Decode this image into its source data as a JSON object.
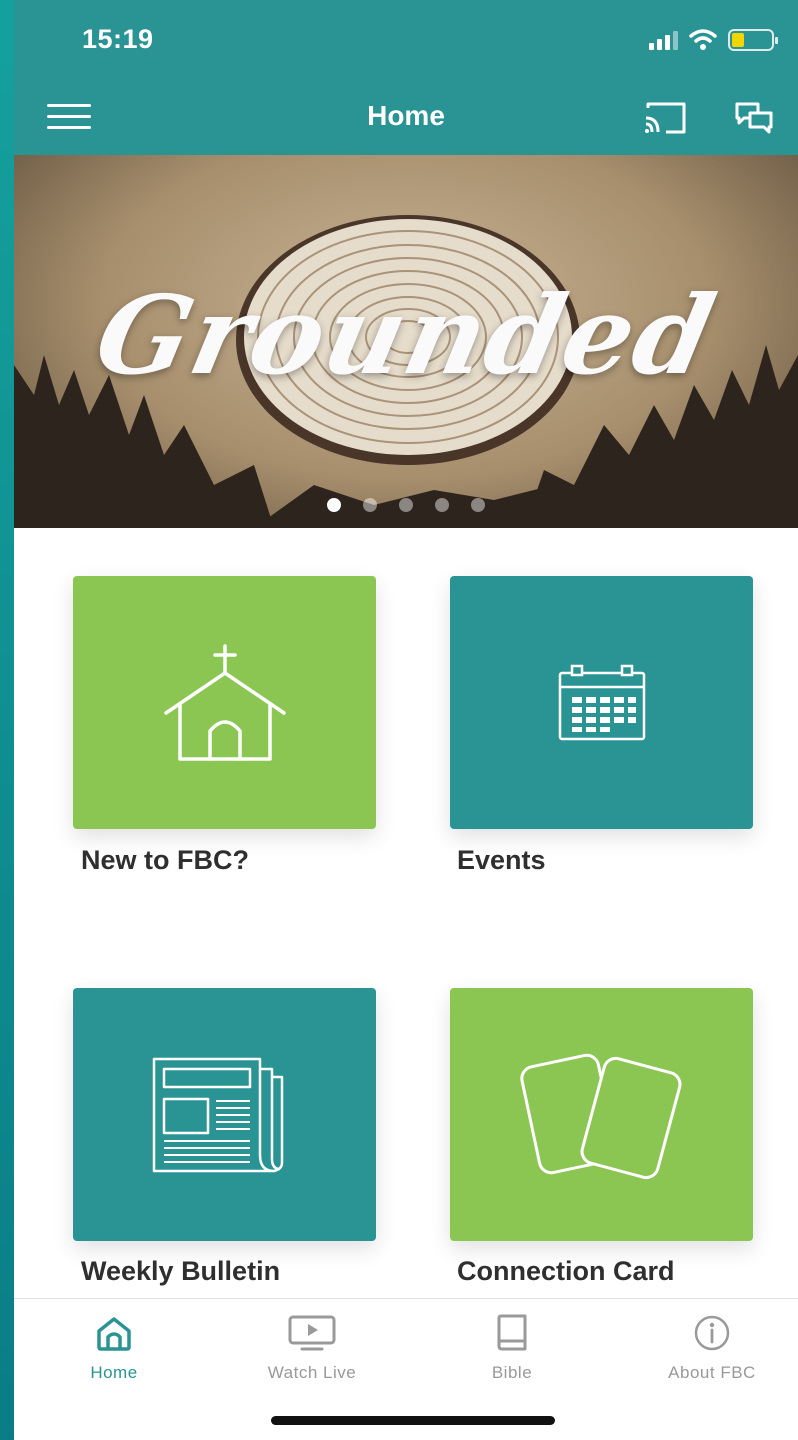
{
  "status_bar": {
    "time": "15:19"
  },
  "header": {
    "title": "Home"
  },
  "banner": {
    "title": "Grounded",
    "dot_count": 5,
    "active_dot": 0
  },
  "tiles": [
    {
      "label": "New to FBC?",
      "icon": "church-icon",
      "color": "#8bc653"
    },
    {
      "label": "Events",
      "icon": "calendar-icon",
      "color": "#2a9494"
    },
    {
      "label": "Weekly Bulletin",
      "icon": "newspaper-icon",
      "color": "#2a9494"
    },
    {
      "label": "Connection Card",
      "icon": "cards-icon",
      "color": "#8bc653"
    }
  ],
  "tabbar": {
    "items": [
      {
        "label": "Home",
        "icon": "home-icon",
        "active": true
      },
      {
        "label": "Watch Live",
        "icon": "tv-play-icon",
        "active": false
      },
      {
        "label": "Bible",
        "icon": "book-icon",
        "active": false
      },
      {
        "label": "About FBC",
        "icon": "info-icon",
        "active": false
      }
    ]
  },
  "colors": {
    "primary_teal": "#2a9494",
    "accent_green": "#8bc653",
    "active_tab": "#2a9494",
    "inactive_tab": "#999999"
  }
}
